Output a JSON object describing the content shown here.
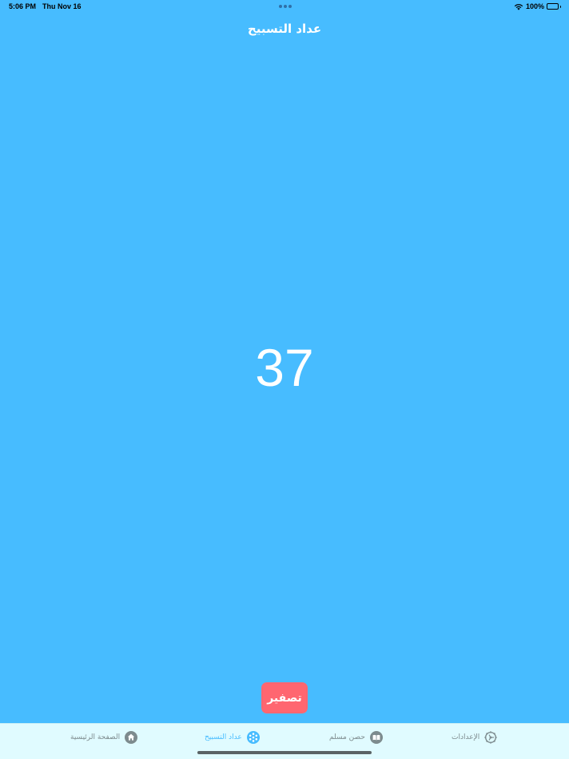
{
  "status_bar": {
    "time": "5:06 PM",
    "date": "Thu Nov 16",
    "battery_percent": "100%",
    "battery_level": 1.0
  },
  "nav": {
    "title": "عداد التسبيح"
  },
  "counter": {
    "value": "37"
  },
  "reset_button": {
    "label": "تصفير"
  },
  "tabs": [
    {
      "label": "الصفحة الرئيسية",
      "icon": "home-icon",
      "active": false
    },
    {
      "label": "عداد التسبيح",
      "icon": "tasbeeh-icon",
      "active": true
    },
    {
      "label": "حصن مسلم",
      "icon": "book-icon",
      "active": false
    },
    {
      "label": "الإعدادات",
      "icon": "gear-icon",
      "active": false
    }
  ],
  "colors": {
    "background": "#47bcff",
    "reset_button": "#ff6670",
    "tab_bar": "#e0fbff",
    "tab_active": "#47bcff",
    "tab_inactive": "#7d8b8e"
  }
}
